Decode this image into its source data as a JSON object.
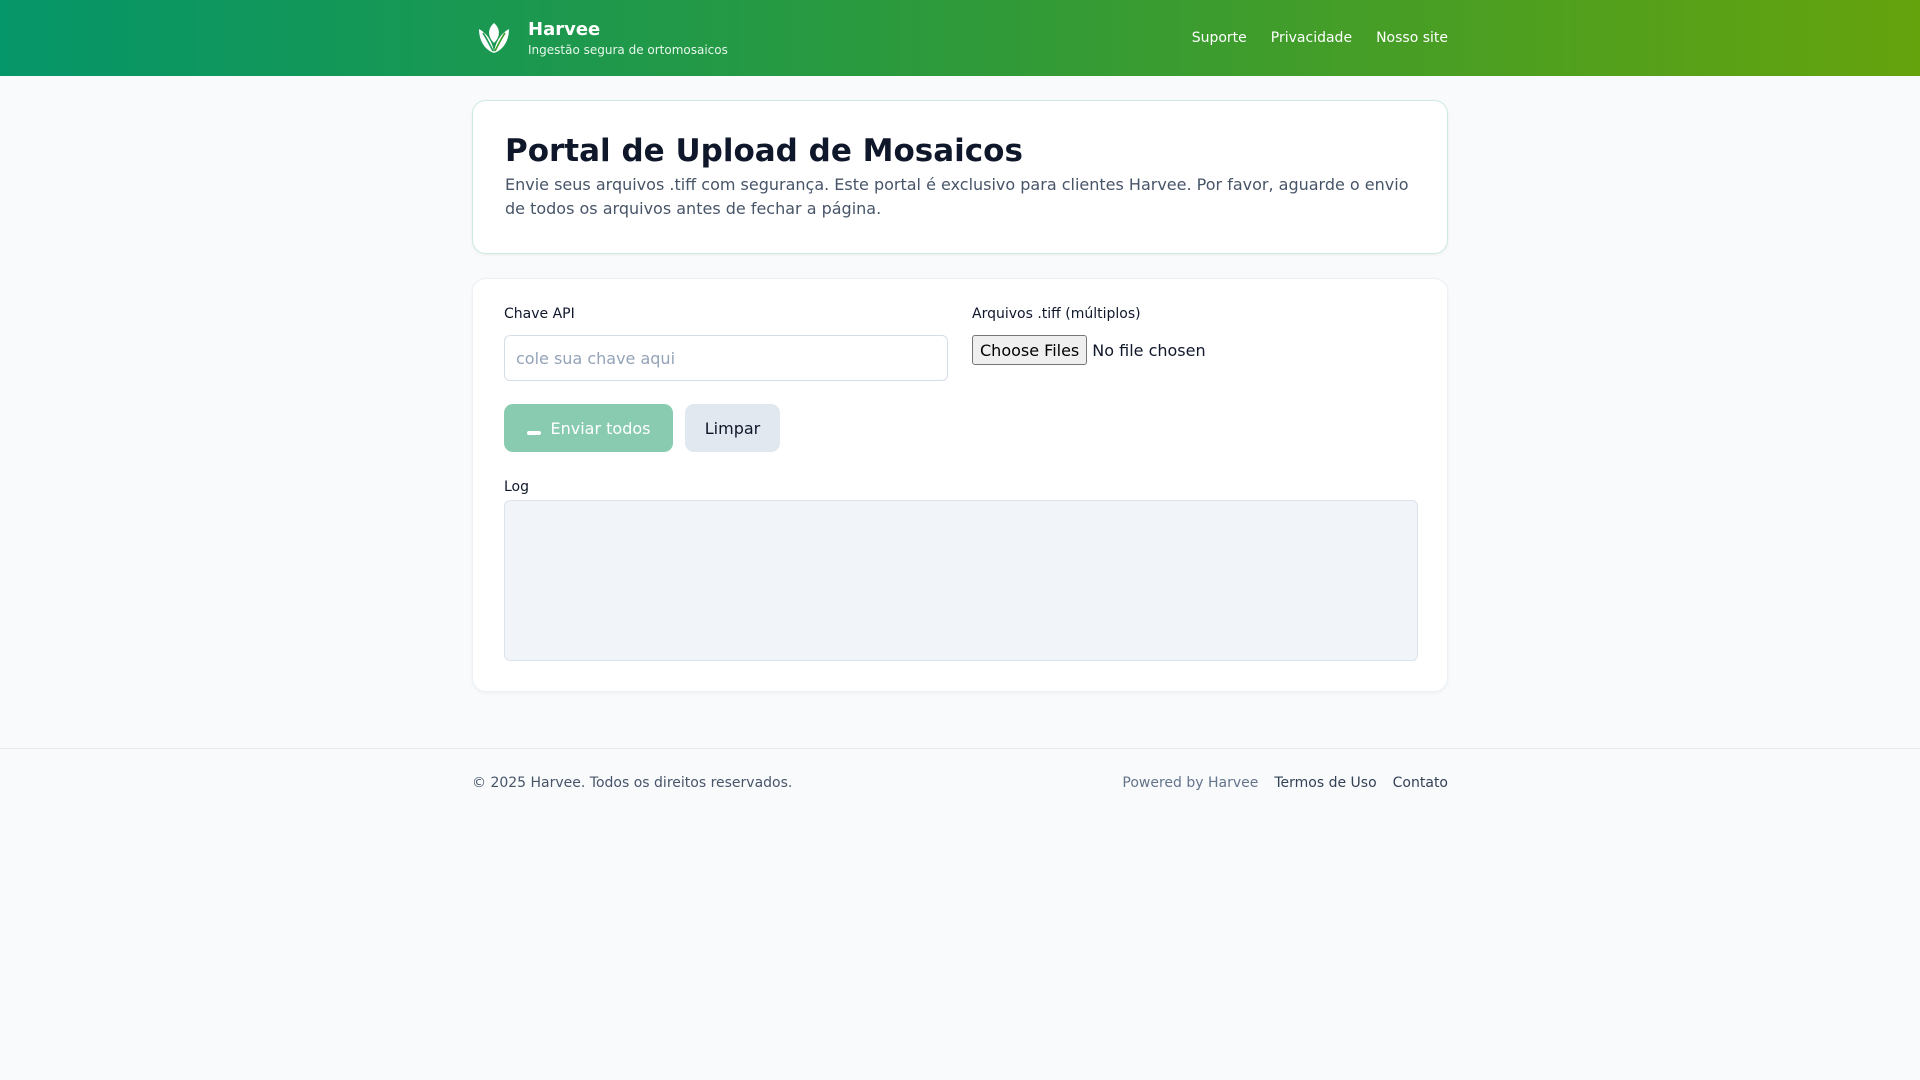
{
  "brand": {
    "name": "Harvee",
    "tagline": "Ingestão segura de ortomosaicos",
    "logo_icon": "leaf-icon"
  },
  "nav": {
    "items": [
      {
        "label": "Suporte"
      },
      {
        "label": "Privacidade"
      },
      {
        "label": "Nosso site"
      }
    ]
  },
  "intro": {
    "title": "Portal de Upload de Mosaicos",
    "description": "Envie seus arquivos .tiff com segurança. Este portal é exclusivo para clientes Harvee. Por favor, aguarde o envio de todos os arquivos antes de fechar a página."
  },
  "form": {
    "api_label": "Chave API",
    "api_placeholder": "cole sua chave aqui",
    "api_value": "",
    "files_label": "Arquivos .tiff (múltiplos)",
    "files_button": "Choose Files",
    "files_status": "No file chosen",
    "send_label": "Enviar todos",
    "send_icon": "spinner-icon",
    "clear_label": "Limpar",
    "log_label": "Log",
    "log_text": ""
  },
  "footer": {
    "copyright": "© 2025 Harvee. Todos os direitos reservados.",
    "powered": "Powered by Harvee",
    "terms": "Termos de Uso",
    "contact": "Contato"
  },
  "colors": {
    "header_gradient_start": "#059669",
    "header_gradient_end": "#65a30d",
    "send_button_disabled": "#88cbb1",
    "clear_button": "#e2e8f0",
    "log_background": "#f1f5f9"
  }
}
